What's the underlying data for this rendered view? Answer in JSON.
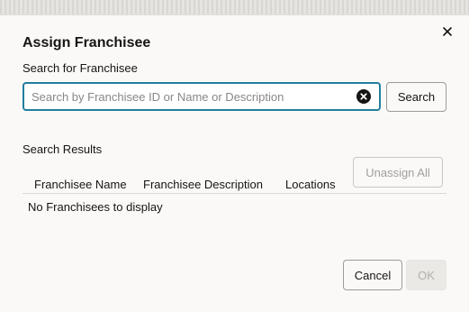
{
  "dialog": {
    "title": "Assign Franchisee",
    "close_icon": "close-icon"
  },
  "search": {
    "label": "Search for Franchisee",
    "value": "",
    "placeholder": "Search by Franchisee ID or Name or Description",
    "clear_icon": "clear-circle-x-icon",
    "button_label": "Search"
  },
  "results": {
    "label": "Search Results",
    "columns": [
      "Franchisee Name",
      "Franchisee Description",
      "Locations"
    ],
    "unassign_all_label": "Unassign All",
    "unassign_all_enabled": false,
    "rows": [],
    "empty_message": "No Franchisees to display"
  },
  "footer": {
    "cancel_label": "Cancel",
    "ok_label": "OK",
    "ok_enabled": false
  },
  "colors": {
    "focus_border": "#227e9e",
    "background": "#fbf9f8",
    "text": "#161513"
  }
}
